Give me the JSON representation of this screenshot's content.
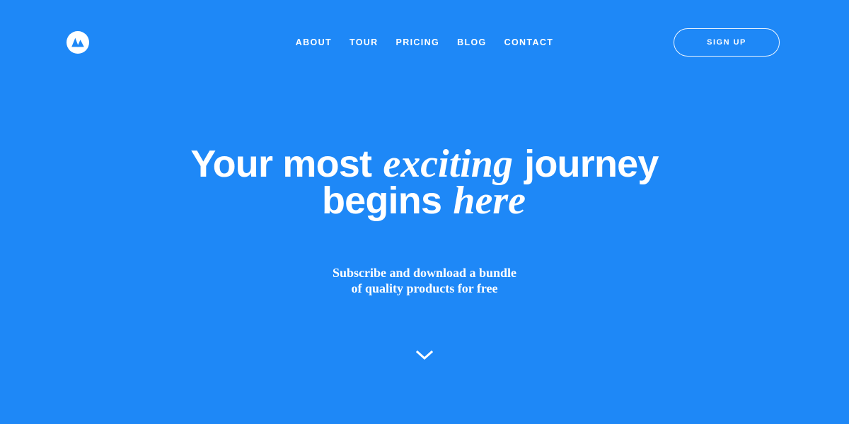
{
  "theme": {
    "background_color": "#1e88f7",
    "foreground_color": "#ffffff"
  },
  "header": {
    "logo": {
      "icon": "mountain-logo-icon",
      "alt": "Mountain logo"
    },
    "nav": {
      "items": [
        {
          "label": "ABOUT"
        },
        {
          "label": "TOUR"
        },
        {
          "label": "PRICING"
        },
        {
          "label": "BLOG"
        },
        {
          "label": "CONTACT"
        }
      ]
    },
    "signup_label": "SIGN UP"
  },
  "hero": {
    "title": {
      "part1": "Your most ",
      "emphasis1": "exciting",
      "part2": " journey",
      "part3": "begins ",
      "emphasis2": "here"
    },
    "subtitle": {
      "line1": "Subscribe and download a bundle",
      "line2": "of quality products for free"
    },
    "scroll_icon": "chevron-down-icon"
  }
}
